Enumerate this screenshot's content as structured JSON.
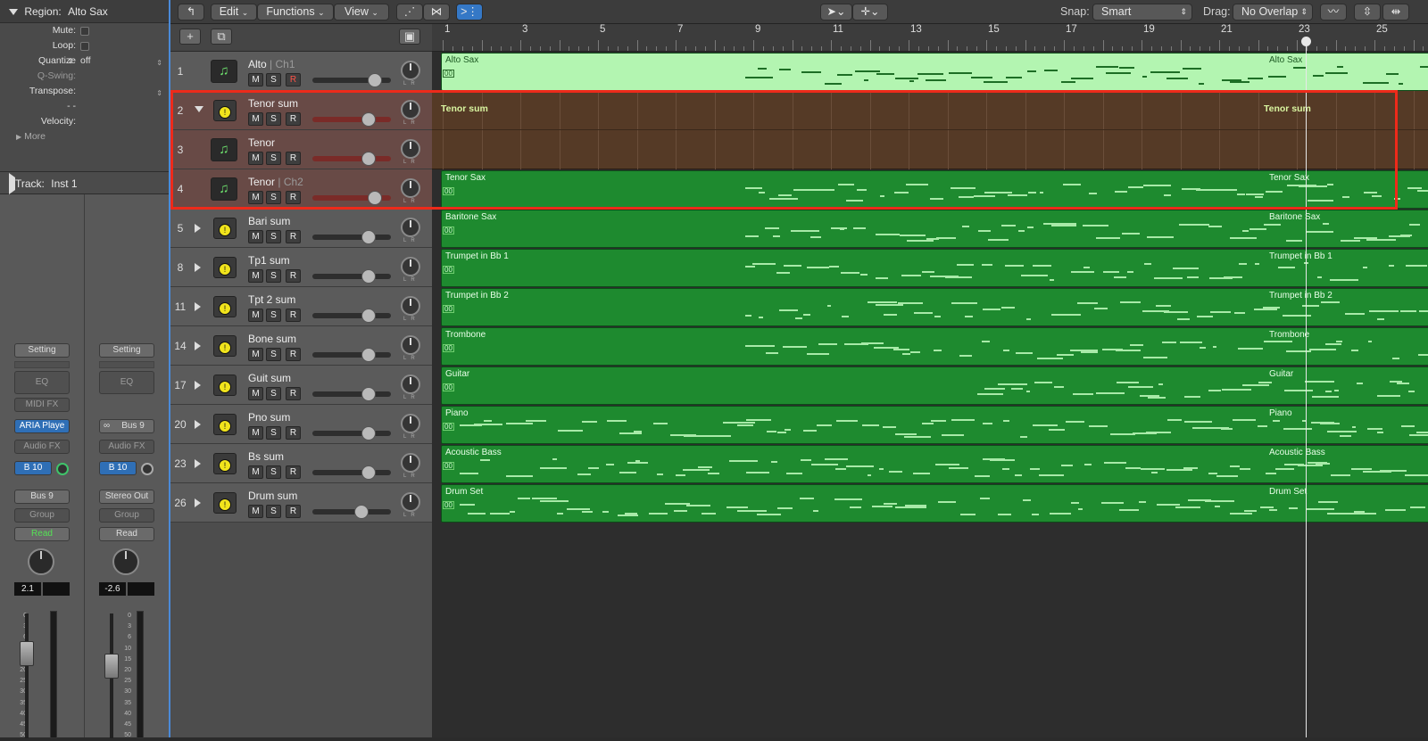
{
  "inspector": {
    "region_title": "Region:",
    "region_name": "Alto Sax",
    "params": {
      "mute": "Mute:",
      "loop": "Loop:",
      "quantize": "Quantize",
      "quantize_value": "off",
      "qswing": "Q-Swing:",
      "transpose": "Transpose:",
      "dashes": "-  -",
      "velocity": "Velocity:",
      "more": "More"
    },
    "track_title": "Track:",
    "track_name": "Inst 1",
    "strip1": {
      "setting": "Setting",
      "eq": "EQ",
      "midifx": "MIDI FX",
      "instrument": "ARIA Playe",
      "audiofx": "Audio FX",
      "send": "B 10",
      "output": "Bus 9",
      "group": "Group",
      "automation": "Read",
      "pan_value": "2.1",
      "fader_level": 0.72
    },
    "strip2": {
      "setting": "Setting",
      "eq": "EQ",
      "input": "Bus 9",
      "audiofx": "Audio FX",
      "send": "B 10",
      "output": "Stereo Out",
      "group": "Group",
      "automation": "Read",
      "pan_value": "-2.6",
      "fader_level": 0.6
    },
    "fader_scale": [
      "0",
      "3",
      "6",
      "10",
      "15",
      "20",
      "25",
      "30",
      "35",
      "40",
      "45",
      "50"
    ]
  },
  "toolbar": {
    "edit": "Edit",
    "functions": "Functions",
    "view": "View",
    "snap_label": "Snap:",
    "snap_value": "Smart",
    "drag_label": "Drag:",
    "drag_value": "No Overlap"
  },
  "tracks": [
    {
      "num": "1",
      "name": "Alto",
      "ch": "Ch1",
      "type": "inst",
      "rec": true,
      "vol": 0.79,
      "selected": false
    },
    {
      "num": "2",
      "name": "Tenor sum",
      "ch": "",
      "type": "sum",
      "open": true,
      "rec": false,
      "vol": 0.72,
      "selected": true
    },
    {
      "num": "3",
      "name": "Tenor",
      "ch": "",
      "type": "inst",
      "rec": false,
      "vol": 0.72,
      "selected": true
    },
    {
      "num": "4",
      "name": "Tenor",
      "ch": "Ch2",
      "type": "inst",
      "rec": false,
      "vol": 0.79,
      "selected": true
    },
    {
      "num": "5",
      "name": "Bari sum",
      "ch": "",
      "type": "sum",
      "rec": false,
      "vol": 0.72,
      "selected": false
    },
    {
      "num": "8",
      "name": "Tp1 sum",
      "ch": "",
      "type": "sum",
      "rec": false,
      "vol": 0.72,
      "selected": false
    },
    {
      "num": "11",
      "name": "Tpt 2 sum",
      "ch": "",
      "type": "sum",
      "rec": false,
      "vol": 0.72,
      "selected": false
    },
    {
      "num": "14",
      "name": "Bone sum",
      "ch": "",
      "type": "sum",
      "rec": false,
      "vol": 0.72,
      "selected": false
    },
    {
      "num": "17",
      "name": "Guit sum",
      "ch": "",
      "type": "sum",
      "rec": false,
      "vol": 0.72,
      "selected": false
    },
    {
      "num": "20",
      "name": "Pno sum",
      "ch": "",
      "type": "sum",
      "rec": false,
      "vol": 0.72,
      "selected": false
    },
    {
      "num": "23",
      "name": "Bs sum",
      "ch": "",
      "type": "sum",
      "rec": false,
      "vol": 0.72,
      "selected": false
    },
    {
      "num": "26",
      "name": "Drum sum",
      "ch": "",
      "type": "sum",
      "rec": false,
      "vol": 0.63,
      "selected": false
    }
  ],
  "ruler": [
    "1",
    "3",
    "5",
    "7",
    "9",
    "11",
    "13",
    "15",
    "17",
    "19",
    "21",
    "23",
    "25"
  ],
  "folder_label": "Tenor sum",
  "regions": [
    {
      "name": "Alto Sax",
      "light": true
    },
    {
      "name": "Tenor Sax",
      "light": false
    },
    {
      "name": "Baritone Sax",
      "light": false
    },
    {
      "name": "Trumpet in Bb 1",
      "light": false
    },
    {
      "name": "Trumpet in Bb 2",
      "light": false
    },
    {
      "name": "Trombone",
      "light": false
    },
    {
      "name": "Guitar",
      "light": false
    },
    {
      "name": "Piano",
      "light": false
    },
    {
      "name": "Acoustic Bass",
      "light": false
    },
    {
      "name": "Drum Set",
      "light": false
    }
  ],
  "loop_marker": "00",
  "msr": {
    "m": "M",
    "s": "S",
    "r": "R"
  }
}
